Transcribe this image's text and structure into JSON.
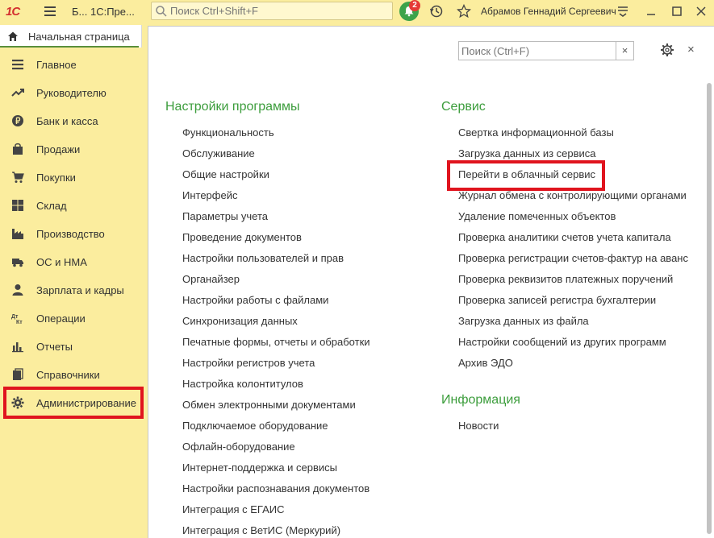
{
  "titlebar": {
    "logo": "1С",
    "app_title": "Б... 1С:Пре...",
    "search_placeholder": "Поиск Ctrl+Shift+F",
    "notifications_count": "2",
    "user_name": "Абрамов Геннадий Сергеевич"
  },
  "home_tab": {
    "label": "Начальная страница"
  },
  "sidebar": {
    "items": [
      {
        "label": "Главное",
        "icon": "menu-lines-icon"
      },
      {
        "label": "Руководителю",
        "icon": "trend-icon"
      },
      {
        "label": "Банк и касса",
        "icon": "ruble-coin-icon"
      },
      {
        "label": "Продажи",
        "icon": "shopping-bag-icon"
      },
      {
        "label": "Покупки",
        "icon": "cart-icon"
      },
      {
        "label": "Склад",
        "icon": "boxes-icon"
      },
      {
        "label": "Производство",
        "icon": "factory-icon"
      },
      {
        "label": "ОС и НМА",
        "icon": "truck-icon"
      },
      {
        "label": "Зарплата и кадры",
        "icon": "person-icon"
      },
      {
        "label": "Операции",
        "icon": "dt-kt-icon"
      },
      {
        "label": "Отчеты",
        "icon": "bar-chart-icon"
      },
      {
        "label": "Справочники",
        "icon": "books-icon"
      },
      {
        "label": "Администрирование",
        "icon": "gear-icon"
      }
    ],
    "highlight_color": "#e0141e"
  },
  "main": {
    "search_placeholder": "Поиск (Ctrl+F)",
    "clear_label": "×",
    "close_label": "×",
    "settings": {
      "title": "Настройки программы",
      "links": [
        "Функциональность",
        "Обслуживание",
        "Общие настройки",
        "Интерфейс",
        "Параметры учета",
        "Проведение документов",
        "Настройки пользователей и прав",
        "Органайзер",
        "Настройки работы с файлами",
        "Синхронизация данных",
        "Печатные формы, отчеты и обработки",
        "Настройки регистров учета",
        "Настройка колонтитулов",
        "Обмен электронными документами",
        "Подключаемое оборудование",
        "Офлайн-оборудование",
        "Интернет-поддержка и сервисы",
        "Настройки распознавания документов",
        "Интеграция с ЕГАИС",
        "Интеграция с ВетИС (Меркурий)"
      ]
    },
    "service": {
      "title": "Сервис",
      "links": [
        "Свертка информационной базы",
        "Загрузка данных из сервиса",
        "Перейти в облачный сервис",
        "Журнал обмена с контролирующими органами",
        "Удаление помеченных объектов",
        "Проверка аналитики счетов учета капитала",
        "Проверка регистрации счетов-фактур на аванс",
        "Проверка реквизитов платежных поручений",
        "Проверка записей регистра бухгалтерии",
        "Загрузка данных из файла",
        "Настройки сообщений из других программ",
        "Архив ЭДО"
      ]
    },
    "info": {
      "title": "Информация",
      "links": [
        "Новости"
      ]
    },
    "section_color": "#3c9d3c"
  }
}
